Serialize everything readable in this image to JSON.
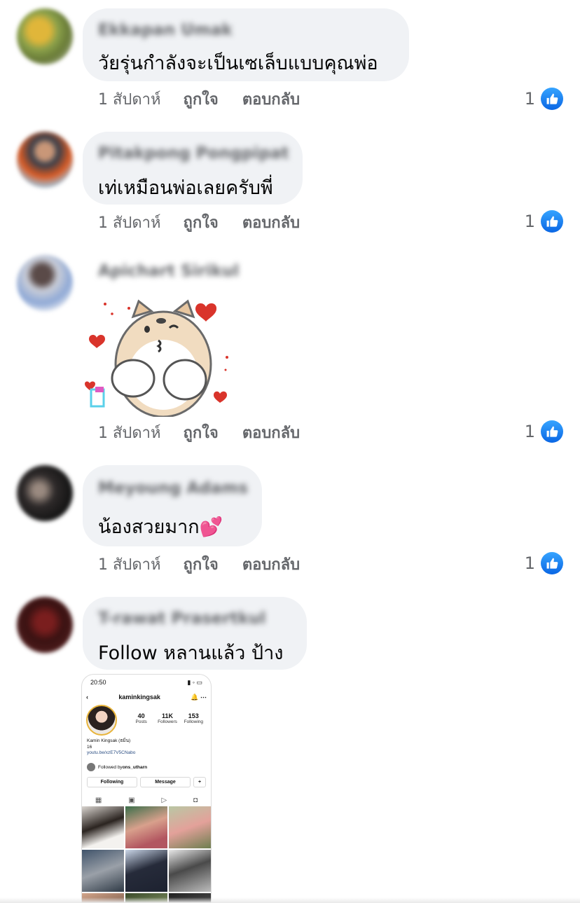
{
  "comments": [
    {
      "author": "Ekkapan Umak",
      "text": "วัยรุ่นกำลังจะเป็นเซเล็บแบบคุณพ่อ",
      "time": "1 สัปดาห์",
      "like_label": "ถูกใจ",
      "reply_label": "ตอบกลับ",
      "reaction_count": "1"
    },
    {
      "author": "Pitakpong Pongpipat",
      "text": "เท่เหมือนพ่อเลยครับพี่",
      "time": "1 สัปดาห์",
      "like_label": "ถูกใจ",
      "reply_label": "ตอบกลับ",
      "reaction_count": "1"
    },
    {
      "author": "Apichart Sirikul",
      "time": "1 สัปดาห์",
      "like_label": "ถูกใจ",
      "reply_label": "ตอบกลับ",
      "reaction_count": "1"
    },
    {
      "author": "Meyoung Adams",
      "text": "น้องสวยมาก💕",
      "time": "1 สัปดาห์",
      "like_label": "ถูกใจ",
      "reply_label": "ตอบกลับ",
      "reaction_count": "1"
    },
    {
      "author": "T-rawat Prasertkul",
      "text": "Follow หลานแล้ว ป้าง"
    }
  ],
  "instagram": {
    "time": "20:50",
    "username": "kaminkingsak",
    "posts": "40",
    "posts_label": "Posts",
    "followers": "11K",
    "followers_label": "Followers",
    "following": "153",
    "following_label": "Following",
    "bio_name": "Kamin Kingsak (ธมิ่น)",
    "bio_age": "16",
    "bio_link": "youtu.be/xzE7V5CNabo",
    "followed_by_prefix": "Followed by ",
    "followed_by_user": "ons_utharn",
    "following_button": "Following",
    "message_button": "Message"
  },
  "colors": {
    "bubble": "#f0f2f5",
    "secondary_text": "#65676b",
    "like_blue": "#1877f2"
  }
}
